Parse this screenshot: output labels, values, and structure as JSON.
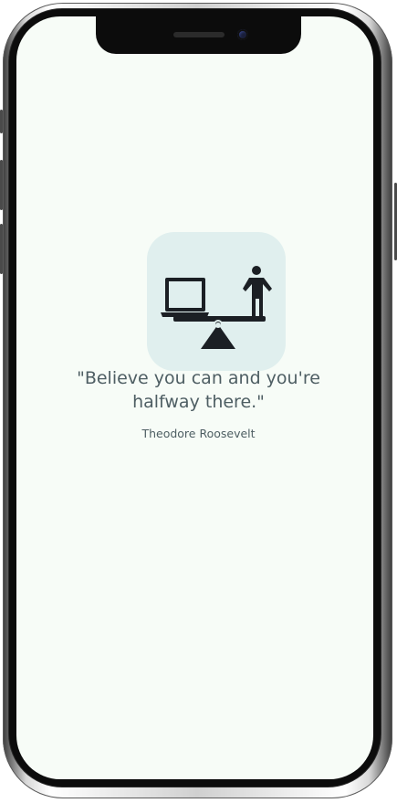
{
  "quote": {
    "line1": "\"Believe you can and you're",
    "line2": "halfway there.\""
  },
  "author": "Theodore Roosevelt",
  "icons": {
    "logo": "laptop-person-balance-icon"
  },
  "colors": {
    "screen_background": "#f7fcf7",
    "logo_tile": "#e0efee",
    "text": "#4e5e63",
    "icon": "#1b1f24"
  }
}
